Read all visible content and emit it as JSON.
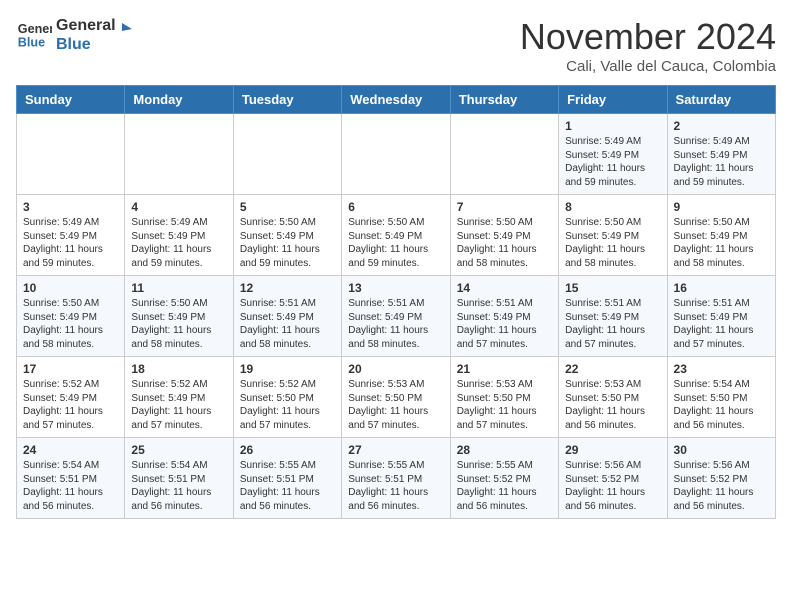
{
  "logo": {
    "line1": "General",
    "line2": "Blue"
  },
  "title": "November 2024",
  "location": "Cali, Valle del Cauca, Colombia",
  "weekdays": [
    "Sunday",
    "Monday",
    "Tuesday",
    "Wednesday",
    "Thursday",
    "Friday",
    "Saturday"
  ],
  "weeks": [
    [
      {
        "day": "",
        "info": ""
      },
      {
        "day": "",
        "info": ""
      },
      {
        "day": "",
        "info": ""
      },
      {
        "day": "",
        "info": ""
      },
      {
        "day": "",
        "info": ""
      },
      {
        "day": "1",
        "info": "Sunrise: 5:49 AM\nSunset: 5:49 PM\nDaylight: 11 hours and 59 minutes."
      },
      {
        "day": "2",
        "info": "Sunrise: 5:49 AM\nSunset: 5:49 PM\nDaylight: 11 hours and 59 minutes."
      }
    ],
    [
      {
        "day": "3",
        "info": "Sunrise: 5:49 AM\nSunset: 5:49 PM\nDaylight: 11 hours and 59 minutes."
      },
      {
        "day": "4",
        "info": "Sunrise: 5:49 AM\nSunset: 5:49 PM\nDaylight: 11 hours and 59 minutes."
      },
      {
        "day": "5",
        "info": "Sunrise: 5:50 AM\nSunset: 5:49 PM\nDaylight: 11 hours and 59 minutes."
      },
      {
        "day": "6",
        "info": "Sunrise: 5:50 AM\nSunset: 5:49 PM\nDaylight: 11 hours and 59 minutes."
      },
      {
        "day": "7",
        "info": "Sunrise: 5:50 AM\nSunset: 5:49 PM\nDaylight: 11 hours and 58 minutes."
      },
      {
        "day": "8",
        "info": "Sunrise: 5:50 AM\nSunset: 5:49 PM\nDaylight: 11 hours and 58 minutes."
      },
      {
        "day": "9",
        "info": "Sunrise: 5:50 AM\nSunset: 5:49 PM\nDaylight: 11 hours and 58 minutes."
      }
    ],
    [
      {
        "day": "10",
        "info": "Sunrise: 5:50 AM\nSunset: 5:49 PM\nDaylight: 11 hours and 58 minutes."
      },
      {
        "day": "11",
        "info": "Sunrise: 5:50 AM\nSunset: 5:49 PM\nDaylight: 11 hours and 58 minutes."
      },
      {
        "day": "12",
        "info": "Sunrise: 5:51 AM\nSunset: 5:49 PM\nDaylight: 11 hours and 58 minutes."
      },
      {
        "day": "13",
        "info": "Sunrise: 5:51 AM\nSunset: 5:49 PM\nDaylight: 11 hours and 58 minutes."
      },
      {
        "day": "14",
        "info": "Sunrise: 5:51 AM\nSunset: 5:49 PM\nDaylight: 11 hours and 57 minutes."
      },
      {
        "day": "15",
        "info": "Sunrise: 5:51 AM\nSunset: 5:49 PM\nDaylight: 11 hours and 57 minutes."
      },
      {
        "day": "16",
        "info": "Sunrise: 5:51 AM\nSunset: 5:49 PM\nDaylight: 11 hours and 57 minutes."
      }
    ],
    [
      {
        "day": "17",
        "info": "Sunrise: 5:52 AM\nSunset: 5:49 PM\nDaylight: 11 hours and 57 minutes."
      },
      {
        "day": "18",
        "info": "Sunrise: 5:52 AM\nSunset: 5:49 PM\nDaylight: 11 hours and 57 minutes."
      },
      {
        "day": "19",
        "info": "Sunrise: 5:52 AM\nSunset: 5:50 PM\nDaylight: 11 hours and 57 minutes."
      },
      {
        "day": "20",
        "info": "Sunrise: 5:53 AM\nSunset: 5:50 PM\nDaylight: 11 hours and 57 minutes."
      },
      {
        "day": "21",
        "info": "Sunrise: 5:53 AM\nSunset: 5:50 PM\nDaylight: 11 hours and 57 minutes."
      },
      {
        "day": "22",
        "info": "Sunrise: 5:53 AM\nSunset: 5:50 PM\nDaylight: 11 hours and 56 minutes."
      },
      {
        "day": "23",
        "info": "Sunrise: 5:54 AM\nSunset: 5:50 PM\nDaylight: 11 hours and 56 minutes."
      }
    ],
    [
      {
        "day": "24",
        "info": "Sunrise: 5:54 AM\nSunset: 5:51 PM\nDaylight: 11 hours and 56 minutes."
      },
      {
        "day": "25",
        "info": "Sunrise: 5:54 AM\nSunset: 5:51 PM\nDaylight: 11 hours and 56 minutes."
      },
      {
        "day": "26",
        "info": "Sunrise: 5:55 AM\nSunset: 5:51 PM\nDaylight: 11 hours and 56 minutes."
      },
      {
        "day": "27",
        "info": "Sunrise: 5:55 AM\nSunset: 5:51 PM\nDaylight: 11 hours and 56 minutes."
      },
      {
        "day": "28",
        "info": "Sunrise: 5:55 AM\nSunset: 5:52 PM\nDaylight: 11 hours and 56 minutes."
      },
      {
        "day": "29",
        "info": "Sunrise: 5:56 AM\nSunset: 5:52 PM\nDaylight: 11 hours and 56 minutes."
      },
      {
        "day": "30",
        "info": "Sunrise: 5:56 AM\nSunset: 5:52 PM\nDaylight: 11 hours and 56 minutes."
      }
    ]
  ]
}
